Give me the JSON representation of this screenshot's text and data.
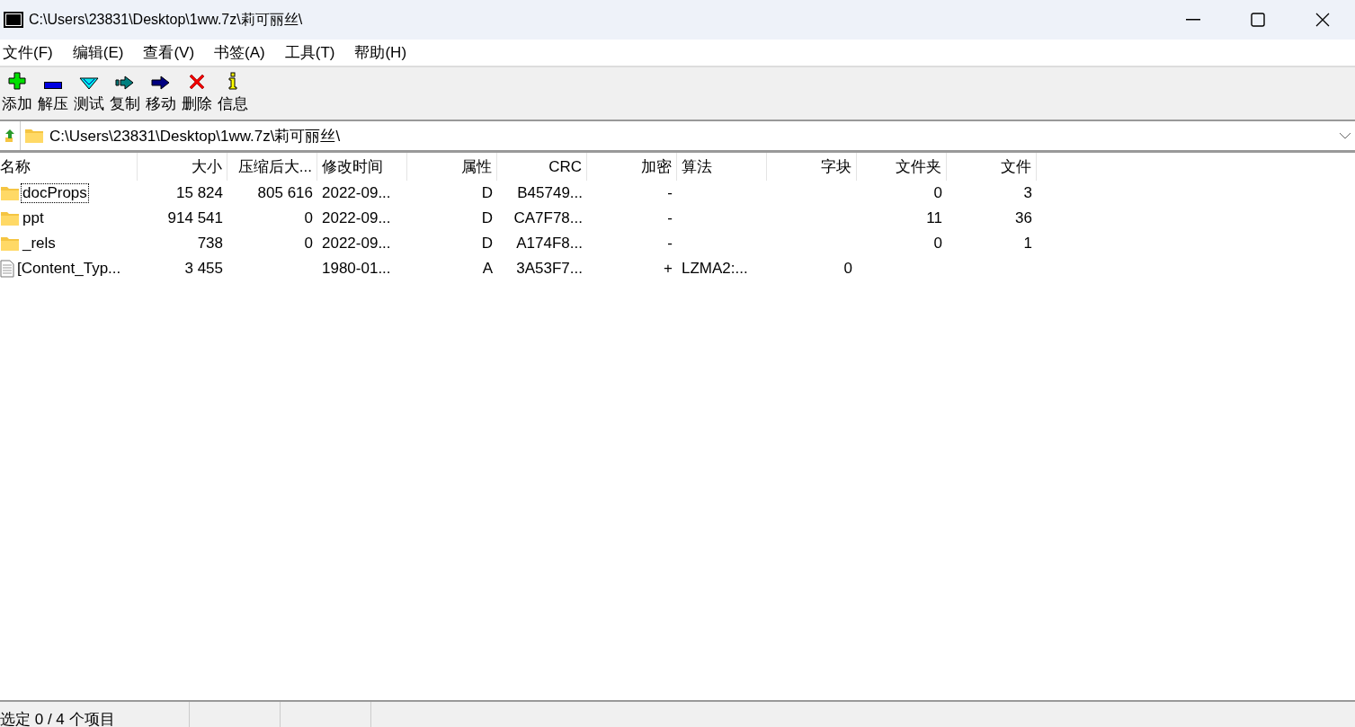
{
  "window": {
    "title": "C:\\Users\\23831\\Desktop\\1ww.7z\\莉可丽丝\\"
  },
  "menu": [
    "文件(F)",
    "编辑(E)",
    "查看(V)",
    "书签(A)",
    "工具(T)",
    "帮助(H)"
  ],
  "toolbar": [
    "添加",
    "解压",
    "测试",
    "复制",
    "移动",
    "删除",
    "信息"
  ],
  "address": {
    "value": "C:\\Users\\23831\\Desktop\\1ww.7z\\莉可丽丝\\"
  },
  "table": {
    "columns": [
      "名称",
      "大小",
      "压缩后大...",
      "修改时间",
      "属性",
      "CRC",
      "加密",
      "算法",
      "字块",
      "文件夹",
      "文件"
    ],
    "rows": [
      {
        "kind": "folder",
        "focused": true,
        "cells": [
          "docProps",
          "15 824",
          "805 616",
          "2022-09...",
          "D",
          "B45749...",
          "-",
          "",
          "",
          "0",
          "3"
        ]
      },
      {
        "kind": "folder",
        "focused": false,
        "cells": [
          "ppt",
          "914 541",
          "0",
          "2022-09...",
          "D",
          "CA7F78...",
          "-",
          "",
          "",
          "11",
          "36"
        ]
      },
      {
        "kind": "folder",
        "focused": false,
        "cells": [
          "_rels",
          "738",
          "0",
          "2022-09...",
          "D",
          "A174F8...",
          "-",
          "",
          "",
          "0",
          "1"
        ]
      },
      {
        "kind": "file",
        "focused": false,
        "cells": [
          "[Content_Typ...",
          "3 455",
          "",
          "1980-01...",
          "A",
          "3A53F7...",
          "+",
          "LZMA2:...",
          "0",
          "",
          ""
        ]
      }
    ]
  },
  "status_bar": {
    "text": "选定 0 / 4 个项目"
  }
}
